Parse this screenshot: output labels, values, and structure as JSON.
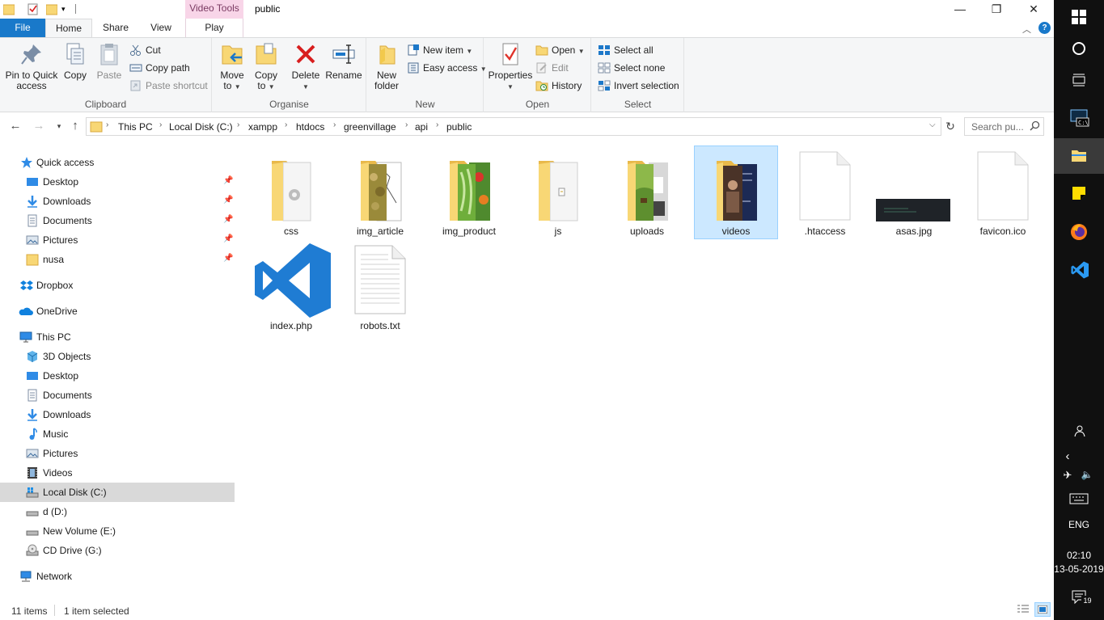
{
  "window": {
    "title": "public",
    "contextual_tab_group": "Video Tools",
    "minimize_glyph": "—",
    "maximize_glyph": "❐",
    "close_glyph": "✕"
  },
  "ribbon_tabs": {
    "file": "File",
    "home": "Home",
    "share": "Share",
    "view": "View",
    "play": "Play"
  },
  "ribbon": {
    "clipboard": {
      "label": "Clipboard",
      "pin_quick_access": "Pin to Quick access",
      "copy": "Copy",
      "paste": "Paste",
      "cut": "Cut",
      "copy_path": "Copy path",
      "paste_shortcut": "Paste shortcut"
    },
    "organise": {
      "label": "Organise",
      "move_to": "Move to",
      "copy_to": "Copy to",
      "delete": "Delete",
      "rename": "Rename"
    },
    "new": {
      "label": "New",
      "new_folder": "New folder",
      "new_item": "New item",
      "easy_access": "Easy access"
    },
    "open": {
      "label": "Open",
      "properties": "Properties",
      "open": "Open",
      "edit": "Edit",
      "history": "History"
    },
    "select": {
      "label": "Select",
      "select_all": "Select all",
      "select_none": "Select none",
      "invert_selection": "Invert selection"
    }
  },
  "address": {
    "crumbs": [
      "This PC",
      "Local Disk (C:)",
      "xampp",
      "htdocs",
      "greenvillage",
      "api",
      "public"
    ],
    "search_placeholder": "Search pu..."
  },
  "nav": {
    "quick_access": "Quick access",
    "quick_items": [
      "Desktop",
      "Downloads",
      "Documents",
      "Pictures",
      "nusa"
    ],
    "dropbox": "Dropbox",
    "onedrive": "OneDrive",
    "this_pc": "This PC",
    "pc_items": [
      "3D Objects",
      "Desktop",
      "Documents",
      "Downloads",
      "Music",
      "Pictures",
      "Videos",
      "Local Disk (C:)",
      "d (D:)",
      "New Volume (E:)",
      "CD Drive (G:)"
    ],
    "network": "Network"
  },
  "files": [
    "css",
    "img_article",
    "img_product",
    "js",
    "uploads",
    "videos",
    ".htaccess",
    "asas.jpg",
    "favicon.ico",
    "index.php",
    "robots.txt"
  ],
  "status": {
    "items": "11 items",
    "selected": "1 item selected"
  },
  "taskbar": {
    "language": "ENG",
    "time": "02:10",
    "date": "13-05-2019",
    "notifications": "19"
  },
  "colors": {
    "accent": "#1979ca",
    "selection": "#cce8ff",
    "folder": "#f8d775",
    "taskbar": "#101010"
  }
}
